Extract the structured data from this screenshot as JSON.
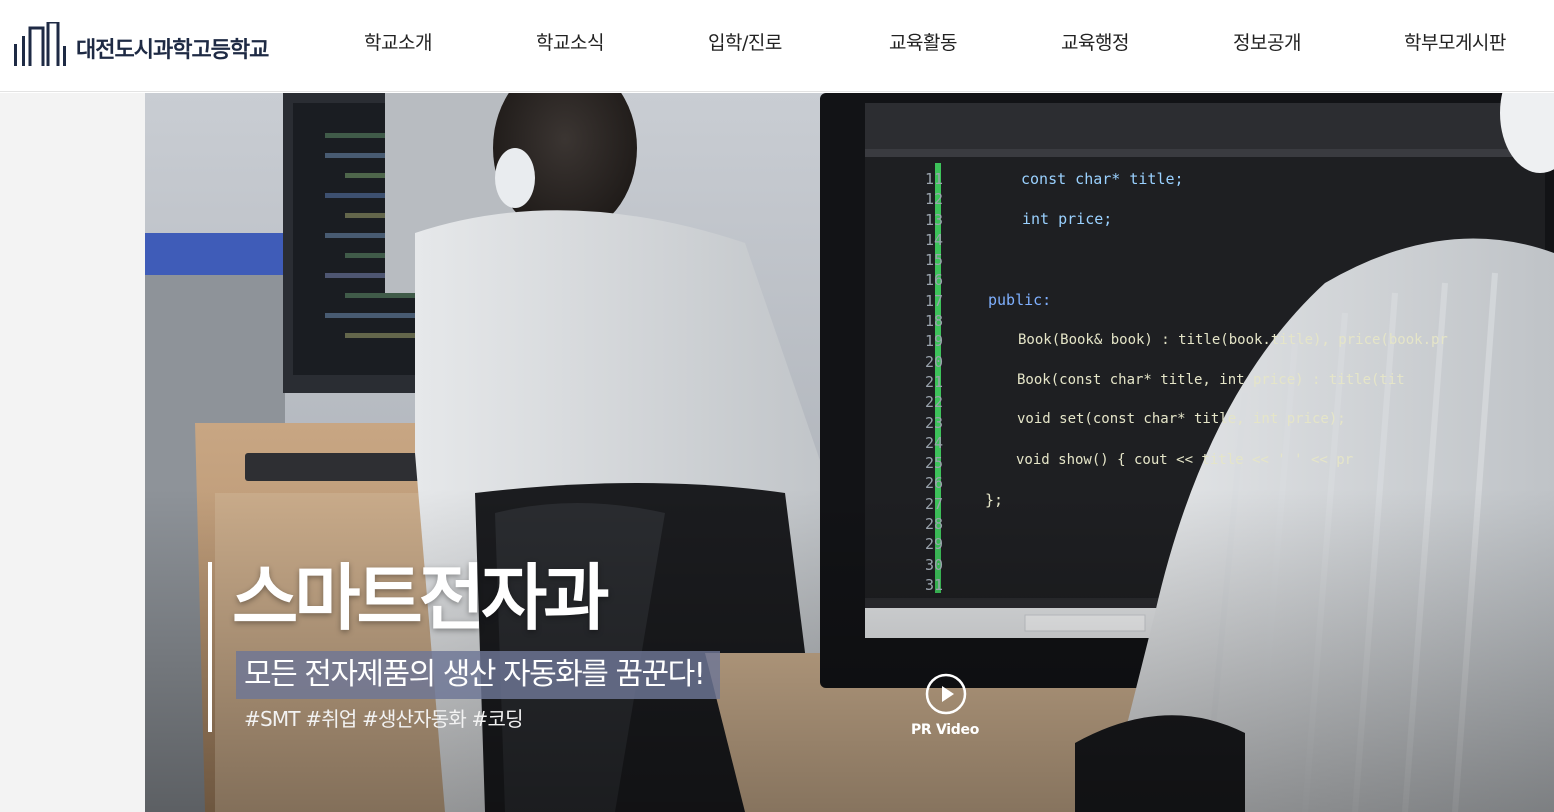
{
  "header": {
    "logo_text": "대전도시과학고등학교",
    "nav": [
      "학교소개",
      "학교소식",
      "입학/진로",
      "교육활동",
      "교육행정",
      "정보공개",
      "학부모게시판"
    ]
  },
  "hero": {
    "title": "스마트전자과",
    "subtitle": "모든 전자제품의 생산 자동화를 꿈꾼다!",
    "tags": "#SMT #취업 #생산자동화 #코딩",
    "video_label": "PR Video",
    "code": {
      "line_numbers": [
        "11",
        "12",
        "13",
        "14",
        "15",
        "16",
        "17",
        "18",
        "19",
        "20",
        "21",
        "22",
        "23",
        "24",
        "25",
        "26",
        "27",
        "28",
        "29",
        "30",
        "31"
      ],
      "lines": [
        "const char* title;",
        "int price;",
        "public:",
        "Book(Book& book) : title(book.title), price(book.pr",
        "Book(const char* title, int price) : title(tit",
        "void set(const char* title, int price);",
        "void show() { cout << title << ' ' << pr",
        "};"
      ]
    }
  },
  "colors": {
    "brand_navy": "#1e2a44",
    "caption_bg": "#6e7696",
    "code_green": "#3dc25a"
  }
}
